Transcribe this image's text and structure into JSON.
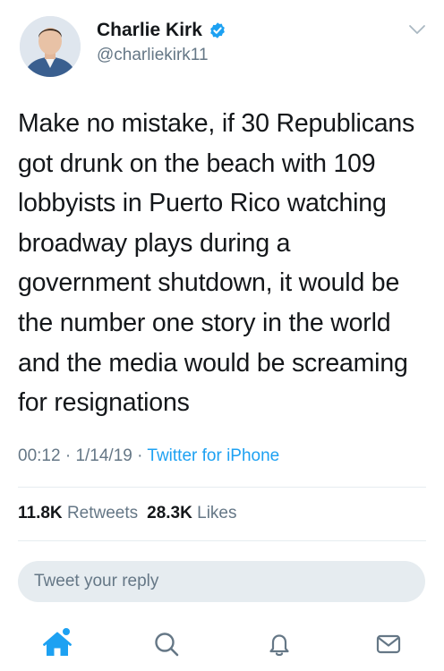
{
  "tweet": {
    "author": {
      "name": "Charlie Kirk",
      "handle": "@charliekirk11",
      "verified": true
    },
    "text_lines": [
      "Make no mistake, if 30 Republicans",
      "got drunk on the beach with 109",
      "lobbyists in Puerto Rico watching",
      "broadway plays during a",
      "government shutdown, it would be",
      "the number one story in the world",
      "and the media would be screaming",
      "for resignations"
    ],
    "time": "00:12",
    "separator": "·",
    "date": "1/14/19",
    "source": "Twitter for iPhone",
    "retweets_count": "11.8K",
    "retweets_label": "Retweets",
    "likes_count": "28.3K",
    "likes_label": "Likes"
  },
  "reply": {
    "placeholder": "Tweet your reply"
  },
  "tabbar": {
    "items": [
      "home-icon",
      "search-icon",
      "notifications-icon",
      "messages-icon"
    ],
    "active": "home-icon",
    "unread_dot": true
  },
  "colors": {
    "accent": "#1da1f2",
    "text_primary": "#14171a",
    "text_secondary": "#657786",
    "divider": "#e6ecf0",
    "reply_box_bg": "#e6ecf0"
  }
}
